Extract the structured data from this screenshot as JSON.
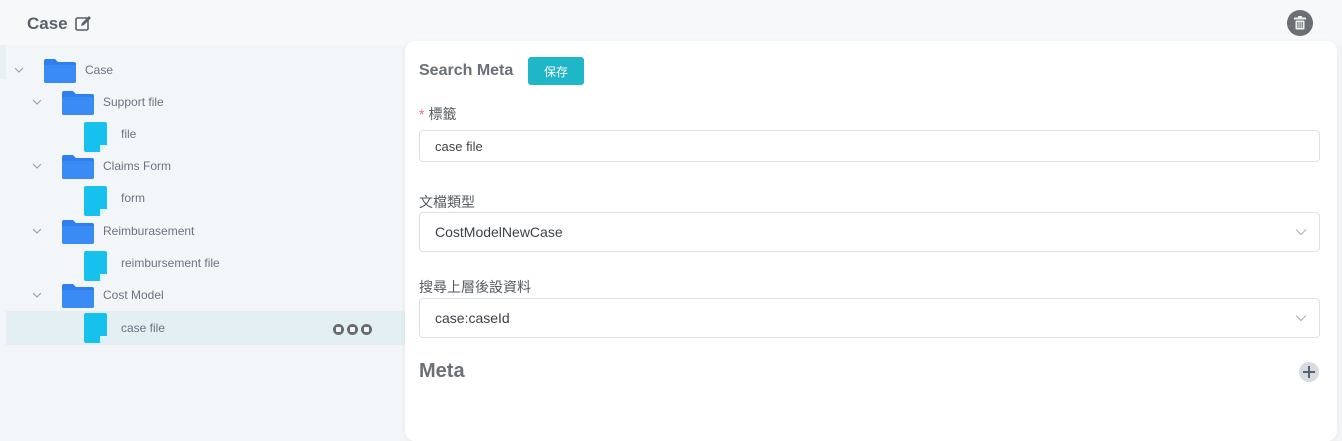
{
  "header": {
    "title": "Case"
  },
  "tree": {
    "items": [
      {
        "label": "Case",
        "type": "folder",
        "expanded": true,
        "selected": false
      },
      {
        "label": "Support file",
        "type": "folder",
        "expanded": true,
        "selected": false
      },
      {
        "label": "file",
        "type": "file",
        "selected": false
      },
      {
        "label": "Claims Form",
        "type": "folder",
        "expanded": true,
        "selected": false
      },
      {
        "label": "form",
        "type": "file",
        "selected": false
      },
      {
        "label": "Reimburasement",
        "type": "folder",
        "expanded": true,
        "selected": false
      },
      {
        "label": "reimbursement file",
        "type": "file",
        "selected": false
      },
      {
        "label": "Cost Model",
        "type": "folder",
        "expanded": true,
        "selected": false
      },
      {
        "label": "case file",
        "type": "file",
        "selected": true
      }
    ]
  },
  "form": {
    "title": "Search Meta",
    "save_label": "保存",
    "tag": {
      "required_mark": "*",
      "label": "標籤",
      "value": "case file"
    },
    "doc_type": {
      "label": "文檔類型",
      "value": "CostModelNewCase"
    },
    "search_parent": {
      "label": "搜尋上層後設資料",
      "value": "case:caseId"
    },
    "meta_title": "Meta"
  },
  "colors": {
    "accent": "#1fb6c7",
    "folder": "#2f7ff0",
    "file": "#17c1ee",
    "required": "#f56c6c",
    "selected_row": "#e3eff2"
  }
}
